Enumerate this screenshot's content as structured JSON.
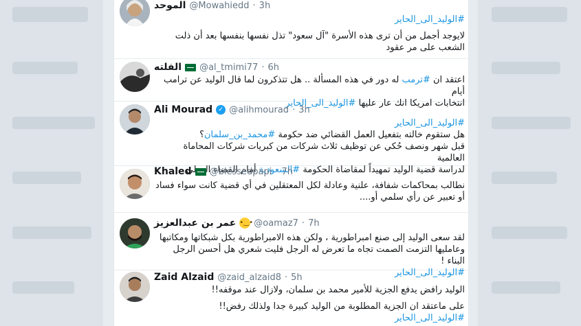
{
  "colors": {
    "link": "#1b95e0",
    "text": "#14171a",
    "meta": "#657786",
    "background": "#e6ecf0",
    "card": "#ffffff",
    "verified": "#1da1f2",
    "flag": "#006c35"
  },
  "tweets": [
    {
      "name": "الموحد",
      "handle": "@Mowahiedd",
      "time": "3h",
      "hashtag": "#الوليد_الى_الحاير",
      "lines": [
        "لايوجد أجمل من أن ترى هذه الأسرة \"آل سعود\" تذل نفسها بنفسها بعد أن ذلت",
        "الشعب  على مر عقود"
      ]
    },
    {
      "name": "الفلته",
      "handle": "@al_tmimi77",
      "time": "6h",
      "line1_text": "اعتقد ان ",
      "line1_link": "#ترمب",
      "line1_rest": " له دور في هذه المسألة .. هل تتذكرون لما قال الوليد عن ترامب أيام",
      "line2_text": "انتخابات امريكا انك عار عليها ",
      "line2_link": "#الوليد_الى_الحاير"
    },
    {
      "name": "Ali Mourad",
      "handle": "@alihmourad",
      "time": "3h",
      "hashtag": "#الوليد_الى_الحاير",
      "line1_text": "هل ستقوم خالته بتفعيل العمل القضائي ضد حكومة ",
      "line1_link": "#محمد_بن_سلمان",
      "line1_rest": "؟",
      "line2": "قبل شهر ونصف حُكي عن توظيف ثلاث شركات من كبريات شركات المحاماة العالمية",
      "line3_text": "لدراسة قضية الوليد تمهيداً لمقاضاة الحكومة ",
      "line3_link": "#السعودية",
      "line3_rest": " أمام القضاء الدولي"
    },
    {
      "name": "Khaled",
      "handle": "@blessedpapi",
      "time": "7h",
      "lines": [
        "نطالب بمحاكمات شفافة، علنية وعادلة لكل المعتقلين في أي قضية كانت سواء فساد",
        "أو تعبير عن رأي سلمي أو...."
      ]
    },
    {
      "name": "عمر بن عبدالعزيز",
      "handle": "@oamaz7",
      "time": "7h",
      "hashtag": "#الوليد_الى_الحاير",
      "lines": [
        "لقد سعى الوليد إلى صنع امبراطورية ، ولكن هذه الامبراطورية بكل شبكاتها ومكاتبها",
        "وعامليها التزمت الصمت تجاه ما تعرض له الرجل فليت شعري هل أحسن الرجل البناء !"
      ]
    },
    {
      "name": "Zaid Alzaid",
      "handle": "@zaid_alzaid8",
      "time": "5h",
      "hashtag": "#الوليد_الى_الحاير",
      "para1": "الوليد رافض يدفع الجزية للأمير محمد بن سلمان، ولازال عند موقفه!!",
      "para2": "على ماعتقد ان الجزية المطلوبة من الوليد كبيرة جدا ولذلك رفض!!"
    }
  ]
}
